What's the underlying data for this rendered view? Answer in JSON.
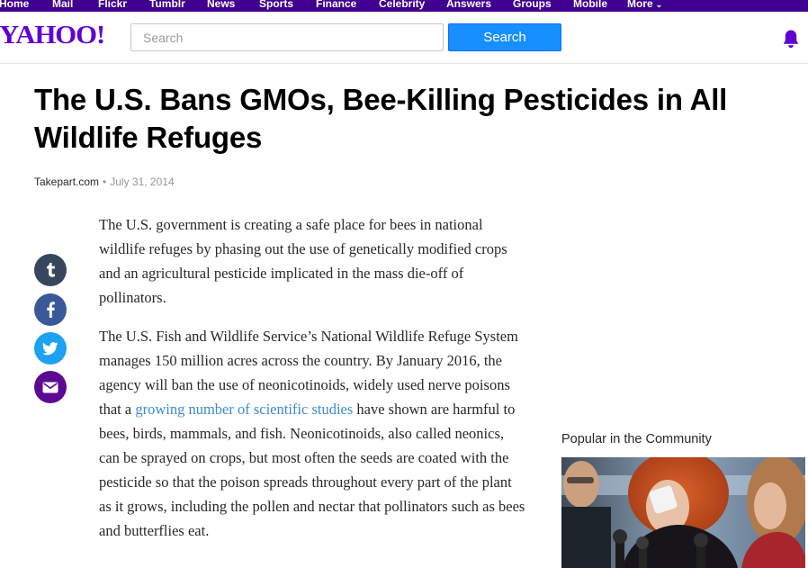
{
  "nav": {
    "items": [
      "Home",
      "Mail",
      "Flickr",
      "Tumblr",
      "News",
      "Sports",
      "Finance",
      "Celebrity",
      "Answers",
      "Groups",
      "Mobile",
      "More"
    ],
    "bg_color": "#400090"
  },
  "header": {
    "logo": "YAHOO!",
    "search_placeholder": "Search",
    "search_button": "Search",
    "brand_color": "#6001d2",
    "button_color": "#188fff",
    "bell_icon": "bell-icon"
  },
  "article": {
    "title": "The U.S. Bans GMOs, Bee-Killing Pesticides in All Wildlife Refuges",
    "source": "Takepart.com",
    "separator": "•",
    "date": "July 31, 2014",
    "paragraph1": "The U.S. government is creating a safe place for bees in national wildlife refuges by phasing out the use of genetically modified crops and an agricultural pesticide implicated in the mass die-off of pollinators.",
    "paragraph2_before_link": "The U.S. Fish and Wildlife Service’s National Wildlife Refuge System manages 150 million acres across the country. By January 2016, the agency will ban the use of neonicotinoids, widely used nerve poisons that a ",
    "paragraph2_link": "growing number of scientific studies",
    "paragraph2_after_link": " have shown are harmful to bees, birds, mammals, and fish. Neonicotinoids, also called neonics, can be sprayed on crops, but most often the seeds are coated with the pesticide so that the poison spreads throughout every part of the plant as it grows, including the pollen and nectar that pollinators such as bees and butterflies eat.",
    "link_color": "#3d8ad2"
  },
  "share": {
    "buttons": [
      {
        "icon": "tumblr-icon",
        "color": "#36465d"
      },
      {
        "icon": "facebook-icon",
        "color": "#3b5998"
      },
      {
        "icon": "twitter-icon",
        "color": "#1da1f2"
      },
      {
        "icon": "mail-icon",
        "color": "#5b0a91"
      }
    ]
  },
  "sidebar": {
    "popular_title": "Popular in the Community"
  }
}
